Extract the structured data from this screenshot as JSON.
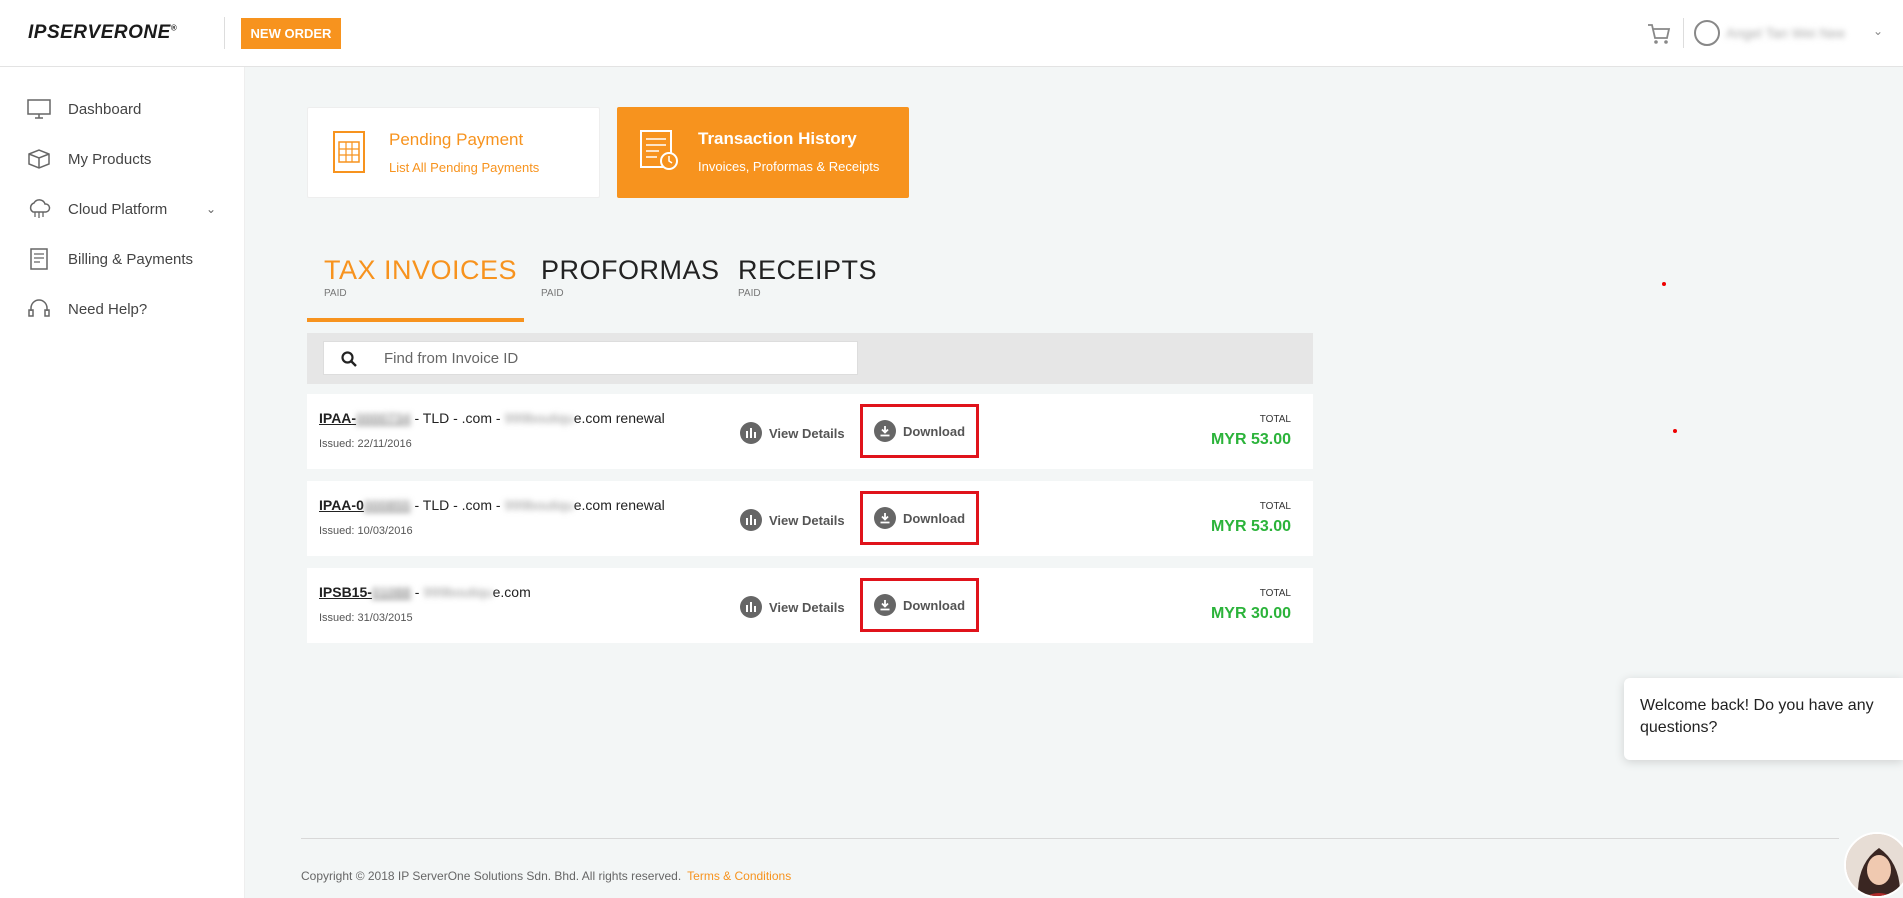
{
  "header": {
    "logo": "IPSERVERONE",
    "logo_mark": "®",
    "new_order_label": "NEW ORDER",
    "user_name": "Angel Tan Wei Nee"
  },
  "sidebar": {
    "items": [
      {
        "label": "Dashboard",
        "icon": "monitor-icon"
      },
      {
        "label": "My Products",
        "icon": "box-icon"
      },
      {
        "label": "Cloud Platform",
        "icon": "cloud-icon",
        "has_submenu": true
      },
      {
        "label": "Billing & Payments",
        "icon": "invoice-icon"
      },
      {
        "label": "Need Help?",
        "icon": "headset-icon"
      }
    ]
  },
  "cards": {
    "pending": {
      "title": "Pending Payment",
      "subtitle": "List All Pending Payments"
    },
    "history": {
      "title": "Transaction History",
      "subtitle": "Invoices, Proformas & Receipts"
    }
  },
  "tabs": [
    {
      "label": "TAX INVOICES",
      "sub": "PAID",
      "active": true
    },
    {
      "label": "PROFORMAS",
      "sub": "PAID",
      "active": false
    },
    {
      "label": "RECEIPTS",
      "sub": "PAID",
      "active": false
    }
  ],
  "search": {
    "placeholder": "Find from Invoice ID"
  },
  "invoices": [
    {
      "id_prefix": "IPAA-",
      "id_hidden": "0000734",
      "desc_pre": " - TLD - .com - ",
      "desc_hidden": "999boutiqu",
      "desc_post": "e.com renewal",
      "issued": "Issued: 22/11/2016",
      "total_label": "TOTAL",
      "total": "MYR 53.00"
    },
    {
      "id_prefix": "IPAA-0",
      "id_hidden": "000855",
      "desc_pre": " - TLD - .com - ",
      "desc_hidden": "999boutiqu",
      "desc_post": "e.com renewal",
      "issued": "Issued: 10/03/2016",
      "total_label": "TOTAL",
      "total": "MYR 53.00"
    },
    {
      "id_prefix": "IPSB15-",
      "id_hidden": "01088",
      "desc_pre": " - ",
      "desc_hidden": "999boutiqu",
      "desc_post": "e.com",
      "issued": "Issued: 31/03/2015",
      "total_label": "TOTAL",
      "total": "MYR 30.00"
    }
  ],
  "actions": {
    "view_details": "View Details",
    "download": "Download"
  },
  "footer": {
    "copyright": "Copyright © 2018 IP ServerOne Solutions Sdn. Bhd. All rights reserved.",
    "terms": "Terms & Conditions"
  },
  "chat": {
    "message": "Welcome back! Do you have any questions?"
  },
  "colors": {
    "accent": "#f7931e",
    "total_green": "#2bb33a",
    "highlight_red": "#e0131b",
    "main_bg": "#f3f6f6"
  }
}
